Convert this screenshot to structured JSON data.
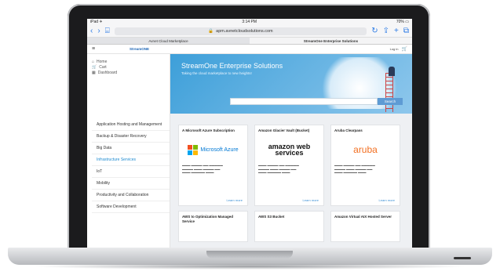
{
  "status_bar": {
    "left": "iPad ✈",
    "time": "3:14 PM",
    "right": "70% ▭"
  },
  "browser": {
    "address": "apm.avnetcloudsolutions.com",
    "tabs": [
      {
        "label": "Avnet Cloud Marketplace",
        "active": false
      },
      {
        "label": "StreamOne Enterprise Solutions",
        "active": true
      }
    ]
  },
  "site": {
    "logo": "StreamONE",
    "login": "Log in",
    "sidebar_links": [
      "Home",
      "Cart",
      "Dashboard"
    ],
    "categories": [
      "Application Hosting and Management",
      "Backup & Disaster Recovery",
      "Big Data",
      "Infrastructure Services",
      "IoT",
      "Mobility",
      "Productivity and Collaboration",
      "Software Development"
    ],
    "highlighted_category": "Infrastructure Services"
  },
  "hero": {
    "title": "StreamOne Enterprise Solutions",
    "subtitle": "Taking the cloud marketplace to new heights!",
    "search_button": "Search"
  },
  "cards": [
    {
      "title": "A Microsoft Azure Subscription",
      "logo": "Microsoft Azure",
      "learn": "Learn more"
    },
    {
      "title": "Amazon Glacier Vault (Bucket)",
      "logo": "amazon web services",
      "learn": "Learn more"
    },
    {
      "title": "Aruba Clearpass",
      "logo": "aruba",
      "learn": "Learn more"
    },
    {
      "title": "AWS to Optimization Managed Service",
      "logo": "",
      "learn": ""
    },
    {
      "title": "AWS S3 Bucket",
      "logo": "",
      "learn": ""
    },
    {
      "title": "Amazon Virtual AIX Hosted Server",
      "logo": "",
      "learn": ""
    }
  ],
  "colors": {
    "hero": "#3d9fd9",
    "link": "#1e8bd0",
    "azure_blue": "#0078d4",
    "amazon_orange": "#f90",
    "aruba_orange": "#f26f21"
  },
  "icons": [
    "back-icon",
    "forward-icon",
    "bookmarks-icon",
    "lock-icon",
    "reload-icon",
    "share-icon",
    "new-tab-icon",
    "tabs-icon",
    "cart-icon"
  ]
}
